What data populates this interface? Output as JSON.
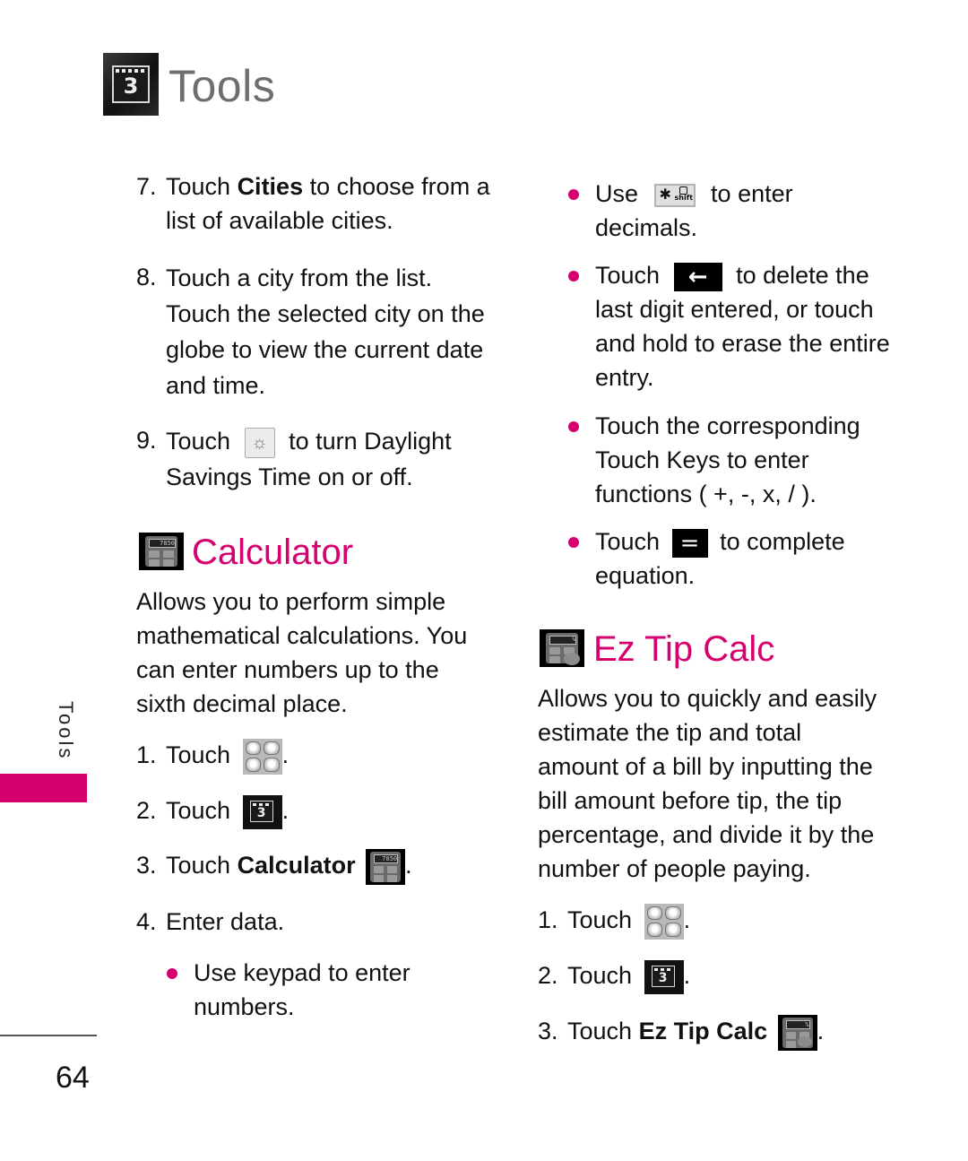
{
  "header": {
    "chapter_icon": "calendar-3-icon",
    "chapter_number": "3",
    "title": "Tools"
  },
  "side_tab": {
    "label": "Tools",
    "accent_color": "#d6006f"
  },
  "page_number": "64",
  "left_column": {
    "steps_continued": [
      {
        "num": "7.",
        "pre": "Touch ",
        "keyword": "Cities",
        "lines": [
          " to choose from a",
          "list of available cities."
        ]
      },
      {
        "num": "8.",
        "lines": [
          "Touch a city from the list.",
          "Touch the selected city on the",
          "globe to view the current date",
          "and time."
        ]
      },
      {
        "num": "9.",
        "pre": "Touch",
        "icon": "daylight-savings-icon",
        "post": " to turn Daylight",
        "line2": "Savings Time on or off."
      }
    ],
    "calculator": {
      "icon": "calculator-icon",
      "calc_display": "7850",
      "title": "Calculator",
      "description": [
        "Allows you to perform simple",
        "mathematical calculations. You",
        "can enter numbers up to the",
        "sixth decimal place."
      ],
      "steps": [
        {
          "num": "1.",
          "text": "Touch",
          "icon": "menu-grid-icon",
          "suffix": "."
        },
        {
          "num": "2.",
          "text": "Touch",
          "icon": "tools-calendar-icon",
          "suffix": "."
        },
        {
          "num": "3.",
          "text": "Touch ",
          "keyword": "Calculator",
          "icon": "calculator-icon",
          "suffix": "."
        },
        {
          "num": "4.",
          "text": "Enter data."
        }
      ],
      "bullets": [
        {
          "lines": [
            "Use keypad to enter",
            "numbers."
          ]
        }
      ]
    }
  },
  "right_column": {
    "calculator_bullets": [
      {
        "pre": "Use",
        "icon": "star-shift-key-icon",
        "key_star": "✱",
        "key_sub": "shift",
        "post": " to enter",
        "line2": "decimals."
      },
      {
        "pre": "Touch",
        "icon": "backspace-arrow-icon",
        "glyph": "←",
        "post": " to delete the",
        "more_lines": [
          "last digit entered, or touch",
          "and hold to erase the entire",
          "entry."
        ]
      },
      {
        "lines": [
          "Touch the corresponding",
          "Touch Keys to enter",
          "functions ( +, -, x, / )."
        ]
      },
      {
        "pre": "Touch",
        "icon": "equals-key-icon",
        "glyph": "=",
        "post": " to complete",
        "line2": "equation."
      }
    ],
    "ez_tip_calc": {
      "icon": "tip-calculator-icon",
      "title": "Ez Tip Calc",
      "description": [
        "Allows you to quickly and easily",
        "estimate the tip and total",
        "amount of a bill by inputting the",
        "bill amount before tip, the tip",
        "percentage, and divide it by the",
        "number of people paying."
      ],
      "steps": [
        {
          "num": "1.",
          "text": "Touch",
          "icon": "menu-grid-icon",
          "suffix": "."
        },
        {
          "num": "2.",
          "text": "Touch",
          "icon": "tools-calendar-icon",
          "suffix": "."
        },
        {
          "num": "3.",
          "text": "Touch ",
          "keyword": "Ez Tip Calc",
          "icon": "tip-calculator-icon",
          "suffix": "."
        }
      ]
    }
  }
}
